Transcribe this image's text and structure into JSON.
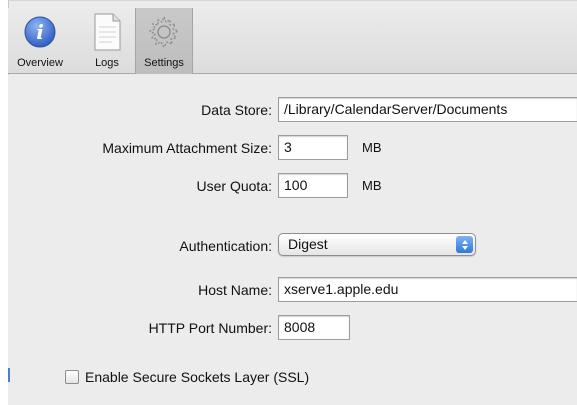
{
  "toolbar": {
    "items": [
      {
        "label": "Overview",
        "icon": "info-icon",
        "selected": false
      },
      {
        "label": "Logs",
        "icon": "document-icon",
        "selected": false
      },
      {
        "label": "Settings",
        "icon": "gear-icon",
        "selected": true
      }
    ]
  },
  "settings": {
    "data_store": {
      "label": "Data Store:",
      "value": "/Library/CalendarServer/Documents"
    },
    "max_attachment": {
      "label": "Maximum Attachment Size:",
      "value": "3",
      "unit": "MB"
    },
    "user_quota": {
      "label": "User Quota:",
      "value": "100",
      "unit": "MB"
    },
    "authentication": {
      "label": "Authentication:",
      "value": "Digest"
    },
    "host_name": {
      "label": "Host Name:",
      "value": "xserve1.apple.edu"
    },
    "http_port": {
      "label": "HTTP Port Number:",
      "value": "8008"
    },
    "ssl": {
      "label": "Enable Secure Sockets Layer (SSL)",
      "checked": false
    }
  },
  "colors": {
    "info_icon": "#3f6fcf",
    "popup_stepper": "#2f78db",
    "pane_background": "#ececec"
  }
}
